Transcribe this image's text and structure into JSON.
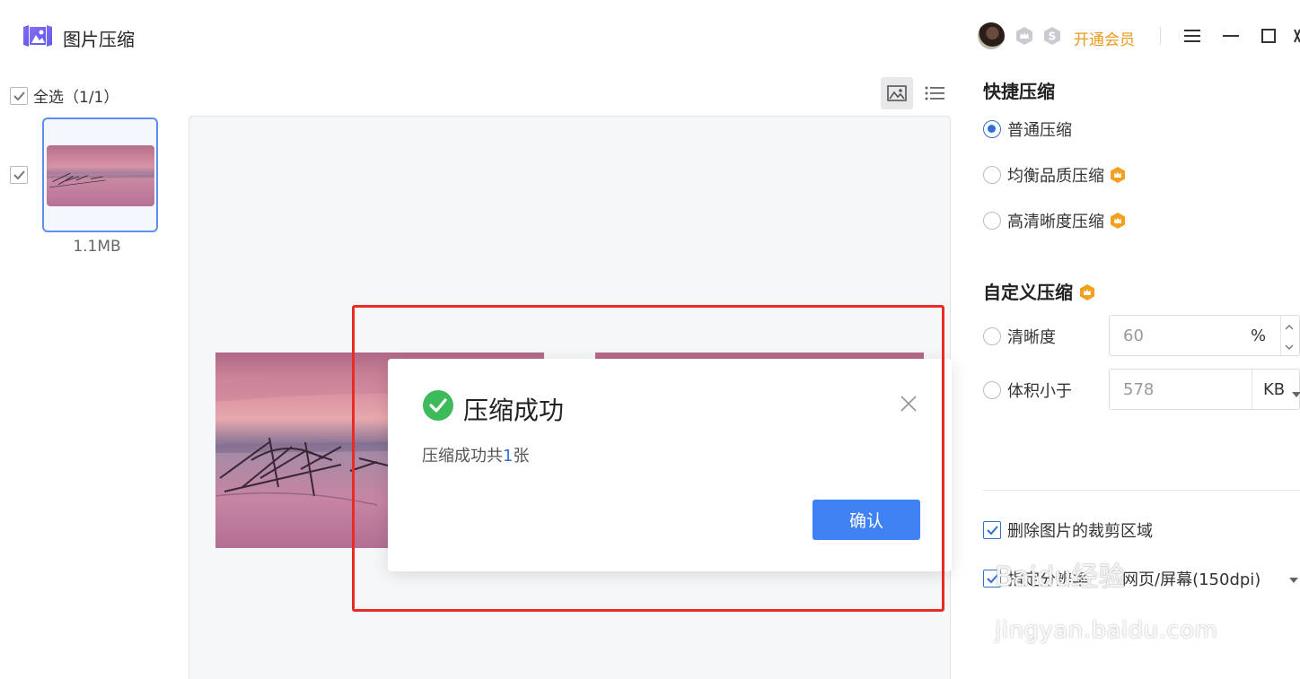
{
  "app": {
    "title": "图片压缩",
    "vip_label": "开通会员"
  },
  "left": {
    "select_all": "全选（1/1）",
    "thumb_size": "1.1MB"
  },
  "dialog": {
    "title": "压缩成功",
    "message_prefix": "压缩成功共",
    "message_count": "1",
    "message_suffix": "张",
    "ok_label": "确认"
  },
  "quick": {
    "title": "快捷压缩",
    "options": [
      "普通压缩",
      "均衡品质压缩",
      "高清晰度压缩"
    ],
    "selected": "普通压缩"
  },
  "custom": {
    "title": "自定义压缩",
    "clarity_label": "清晰度",
    "clarity_value": "60",
    "clarity_unit": "%",
    "size_label": "体积小于",
    "size_value": "578",
    "size_unit": "KB"
  },
  "options": {
    "crop_label": "删除图片的裁剪区域",
    "dpi_label": "指定分辨率",
    "dpi_value": "网页/屏幕(150dpi)"
  },
  "watermark": {
    "main": "Baidu经验",
    "sub": "jingyan.baidu.com"
  },
  "colors": {
    "accent": "#3f82f3",
    "vip": "#e89a1c",
    "success": "#3dbb5a",
    "highlight_box": "#e82b25"
  }
}
